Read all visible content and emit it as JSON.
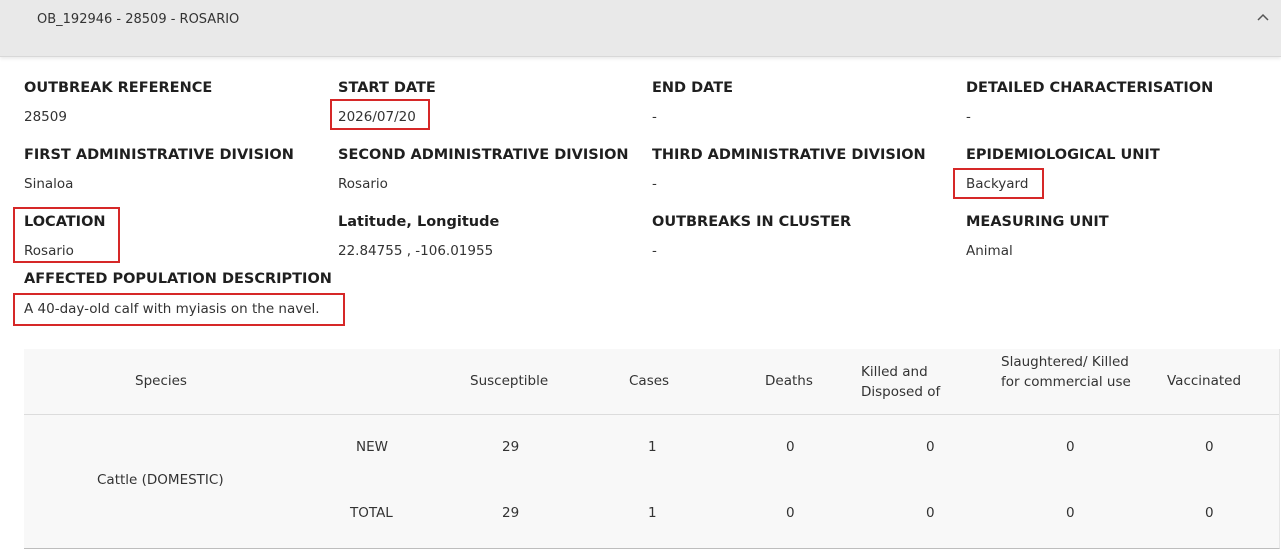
{
  "header": {
    "title": "OB_192946 - 28509 - ROSARIO"
  },
  "fields": {
    "outbreak_reference": {
      "label": "OUTBREAK REFERENCE",
      "value": "28509"
    },
    "start_date": {
      "label": "START DATE",
      "value": "2026/07/20"
    },
    "end_date": {
      "label": "END DATE",
      "value": "-"
    },
    "detailed_characterisation": {
      "label": "DETAILED CHARACTERISATION",
      "value": "-"
    },
    "first_admin_division": {
      "label": "FIRST ADMINISTRATIVE DIVISION",
      "value": "Sinaloa"
    },
    "second_admin_division": {
      "label": "SECOND ADMINISTRATIVE DIVISION",
      "value": "Rosario"
    },
    "third_admin_division": {
      "label": "THIRD ADMINISTRATIVE DIVISION",
      "value": "-"
    },
    "epidemiological_unit": {
      "label": "EPIDEMIOLOGICAL UNIT",
      "value": "Backyard"
    },
    "location": {
      "label": "LOCATION",
      "value": "Rosario"
    },
    "lat_long": {
      "label": "Latitude, Longitude",
      "value": "22.84755 , -106.01955"
    },
    "outbreaks_in_cluster": {
      "label": "OUTBREAKS IN CLUSTER",
      "value": "-"
    },
    "measuring_unit": {
      "label": "MEASURING UNIT",
      "value": "Animal"
    },
    "affected_population": {
      "label": "AFFECTED POPULATION DESCRIPTION",
      "value": "A 40-day-old calf with myiasis on the navel."
    }
  },
  "table": {
    "headers": {
      "species": "Species",
      "susceptible": "Susceptible",
      "cases": "Cases",
      "deaths": "Deaths",
      "killed_disposed": "Killed and Disposed of",
      "slaughtered": "Slaughtered/ Killed for commercial use",
      "vaccinated": "Vaccinated"
    },
    "species_name": "Cattle (DOMESTIC)",
    "rows": [
      {
        "type": "NEW",
        "susceptible": "29",
        "cases": "1",
        "deaths": "0",
        "killed_disposed": "0",
        "slaughtered": "0",
        "vaccinated": "0"
      },
      {
        "type": "TOTAL",
        "susceptible": "29",
        "cases": "1",
        "deaths": "0",
        "killed_disposed": "0",
        "slaughtered": "0",
        "vaccinated": "0"
      }
    ]
  },
  "colors": {
    "highlight": "#d62828",
    "header_bg": "#e9e9e9",
    "table_bg": "#f8f8f8"
  }
}
